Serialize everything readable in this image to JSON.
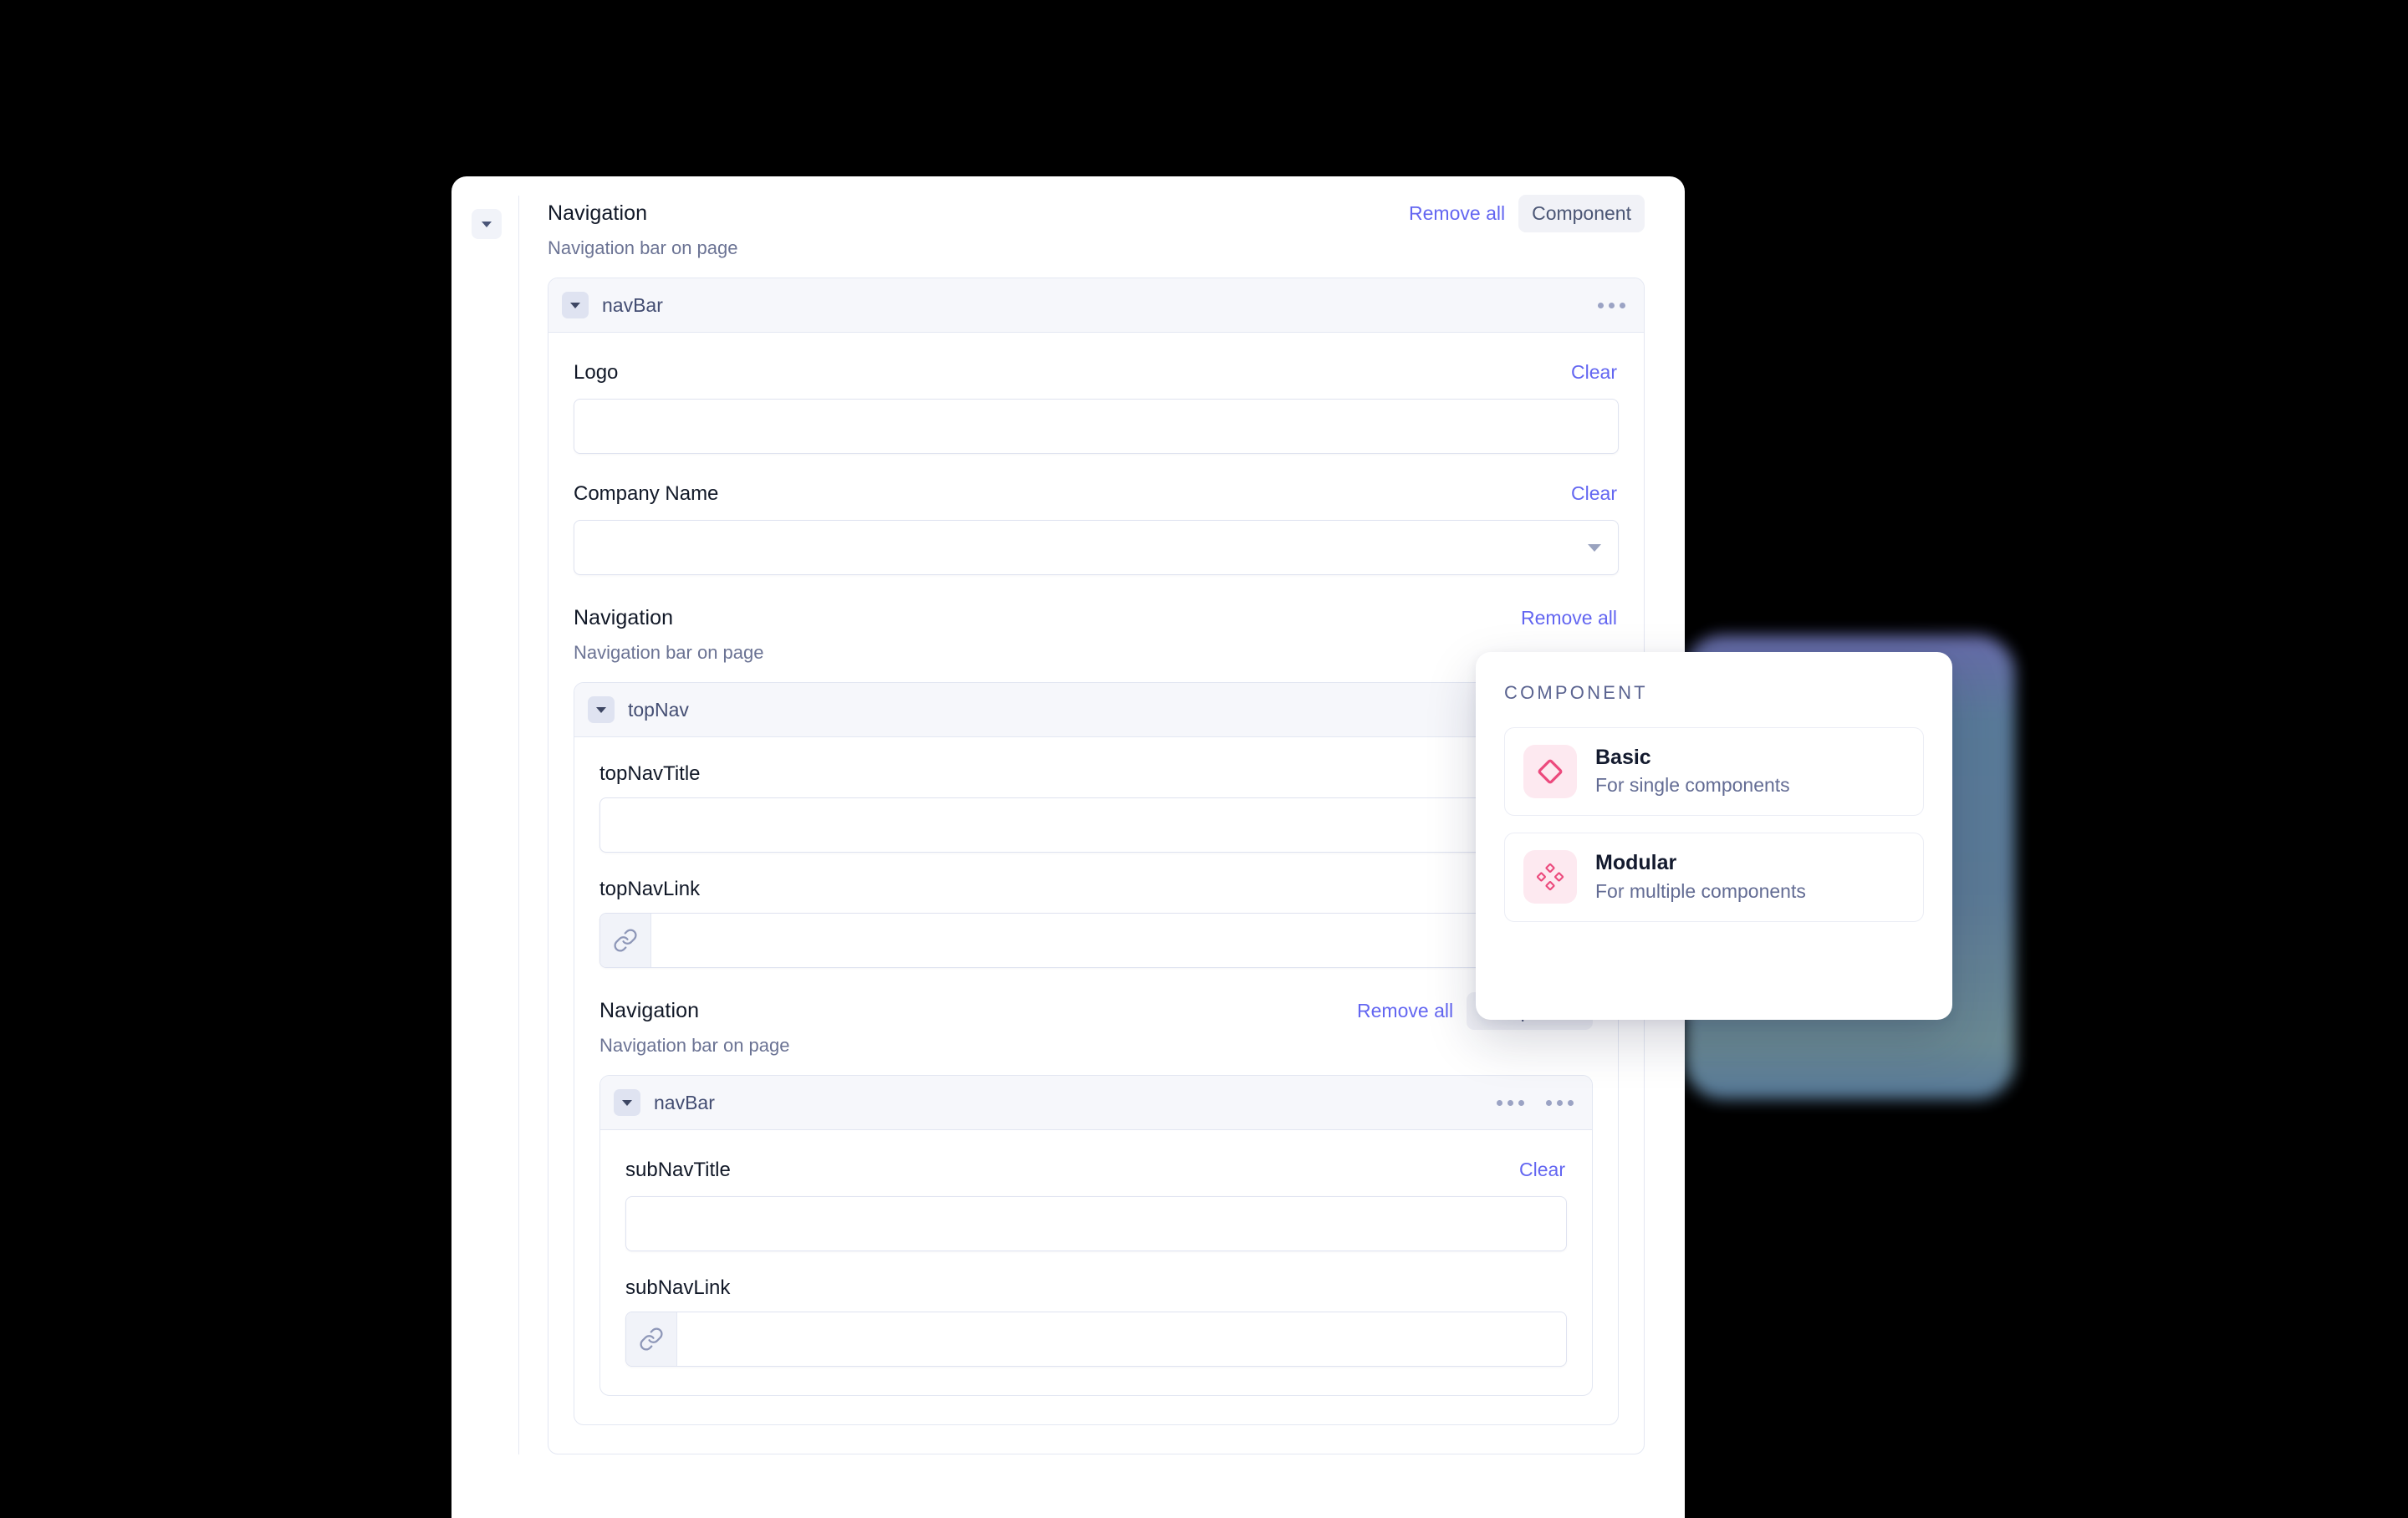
{
  "sections": {
    "root": {
      "title": "Navigation",
      "description": "Navigation bar on page",
      "remove_all_label": "Remove all",
      "component_label": "Component",
      "panel_name": "navBar",
      "fields": {
        "logo": {
          "label": "Logo",
          "clear_label": "Clear",
          "value": "",
          "placeholder": ""
        },
        "company_name": {
          "label": "Company Name",
          "clear_label": "Clear",
          "value": "",
          "placeholder": ""
        }
      }
    },
    "level2": {
      "title": "Navigation",
      "description": "Navigation bar on page",
      "remove_all_label": "Remove all",
      "panel_name": "topNav",
      "fields": {
        "top_nav_title": {
          "label": "topNavTitle",
          "value": "",
          "placeholder": ""
        },
        "top_nav_link": {
          "label": "topNavLink",
          "value": "",
          "placeholder": "",
          "addon_icon": "link-icon"
        }
      }
    },
    "level3": {
      "title": "Navigation",
      "description": "Navigation bar on page",
      "remove_all_label": "Remove all",
      "component_label": "Component",
      "panel_name": "navBar",
      "fields": {
        "sub_nav_title": {
          "label": "subNavTitle",
          "clear_label": "Clear",
          "value": "",
          "placeholder": ""
        },
        "sub_nav_link": {
          "label": "subNavLink",
          "value": "",
          "placeholder": "",
          "addon_icon": "link-icon"
        }
      }
    }
  },
  "popup": {
    "title": "COMPONENT",
    "options": [
      {
        "name": "Basic",
        "description": "For single components",
        "icon": "diamond-outline-icon"
      },
      {
        "name": "Modular",
        "description": "For multiple components",
        "icon": "four-diamonds-icon"
      }
    ]
  },
  "colors": {
    "accent_link": "#6366f1",
    "icon_pink": "#ec4a7d",
    "icon_pink_bg": "#fde9f0",
    "text_primary": "#111827",
    "text_muted": "#6b7394",
    "panel_header_bg": "#f6f7fb",
    "chip_bg": "#f1f2f7"
  }
}
